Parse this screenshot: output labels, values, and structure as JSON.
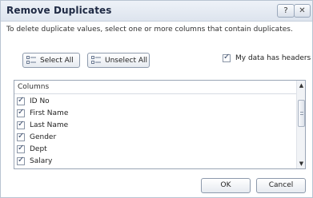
{
  "window": {
    "title": "Remove Duplicates",
    "help_glyph": "?",
    "close_glyph": "✕"
  },
  "instruction": "To delete duplicate values, select one or more columns that contain duplicates.",
  "buttons": {
    "select_all": "Select All",
    "unselect_all": "Unselect All",
    "ok": "OK",
    "cancel": "Cancel"
  },
  "options": {
    "my_data_has_headers": {
      "label": "My data has headers",
      "checked": true
    }
  },
  "columns_list": {
    "header": "Columns",
    "items": [
      {
        "label": "ID No",
        "checked": true
      },
      {
        "label": "First Name",
        "checked": true
      },
      {
        "label": "Last Name",
        "checked": true
      },
      {
        "label": "Gender",
        "checked": true
      },
      {
        "label": "Dept",
        "checked": true
      },
      {
        "label": "Salary",
        "checked": true
      }
    ]
  },
  "icons": {
    "check_glyph": "✓",
    "scroll_up": "▲",
    "scroll_down": "▼"
  }
}
